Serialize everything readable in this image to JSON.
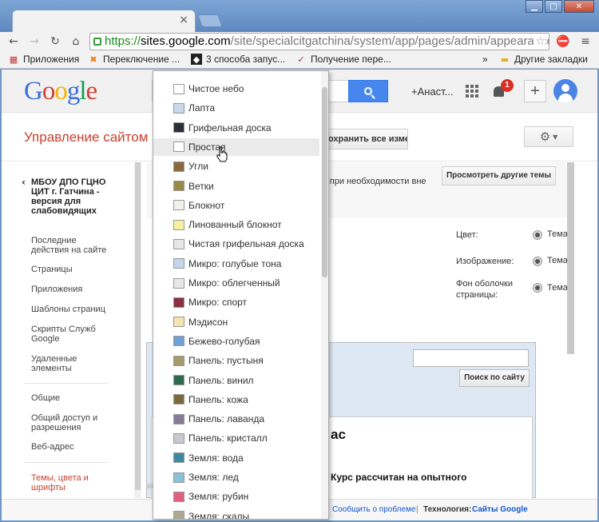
{
  "browser": {
    "tab_close": "×",
    "window_buttons": [
      "▁",
      "□",
      "✕"
    ],
    "url_https": "https://",
    "url_domain": "sites.google.com",
    "url_path": "/site/specialcitgatchina/system/app/pages/admin/appearance/tl",
    "bookmarks": [
      {
        "label": "Приложения",
        "icon": "apps-icon"
      },
      {
        "label": "Переключение ...",
        "icon": "joomla-icon"
      },
      {
        "label": "3 способа запус...",
        "icon": "diamond-icon"
      },
      {
        "label": "Получение пере...",
        "icon": "check-icon"
      }
    ],
    "bookmarks_more": "»",
    "other_bookmarks": "Другие закладки"
  },
  "google_bar": {
    "user": "+Анаст...",
    "notifications": "1"
  },
  "admin": {
    "title": "Управление сайтом",
    "save_all": "Сохранить все изменения"
  },
  "sidebar": {
    "site_name": "МБОУ ДПО ГЦНО ЦИТ г. Гатчина - версия для слабовидящих",
    "items": [
      "Последние действия на сайте",
      "Страницы",
      "Приложения",
      "Шаблоны страниц",
      "Скрипты Служб Google",
      "Удаленные элементы",
      "Общие",
      "Общий доступ и разрешения",
      "Веб-адрес",
      "Темы, цвета и шрифты"
    ]
  },
  "main": {
    "info_text": "у и при необходимости вне",
    "other_themes_button": "Просмотреть другие темы",
    "options": [
      {
        "label": "Цвет:",
        "value": "Тема"
      },
      {
        "label": "Изображение:",
        "value": "Тема"
      },
      {
        "label": "Фон оболочки страницы:",
        "value": "Тема"
      }
    ],
    "preview_search_button": "Поиск по сайту",
    "preview_heading": "ас",
    "preview_text": "Курс рассчитан на опытного"
  },
  "footer": {
    "report": "Сообщить о проблеме",
    "separator": "|",
    "tech_label": "Технология:",
    "tech_link": "Сайты Google"
  },
  "theme_dropdown": {
    "hovered": "Простая",
    "items": [
      {
        "label": "Чистое небо",
        "color": "#ffffff"
      },
      {
        "label": "Лапта",
        "color": "#c8d8ea"
      },
      {
        "label": "Грифельная доска",
        "color": "#2b2f36"
      },
      {
        "label": "Простая",
        "color": "#ffffff"
      },
      {
        "label": "Угли",
        "color": "#8a6a3c"
      },
      {
        "label": "Ветки",
        "color": "#9a8a4a"
      },
      {
        "label": "Блокнот",
        "color": "#f2f2e8"
      },
      {
        "label": "Линованный блокнот",
        "color": "#f4f0a0"
      },
      {
        "label": "Чистая грифельная доска",
        "color": "#e6e6e6"
      },
      {
        "label": "Микро: голубые тона",
        "color": "#c6d4ec"
      },
      {
        "label": "Микро: облегченный",
        "color": "#e8e8e8"
      },
      {
        "label": "Микро: спорт",
        "color": "#8a3040"
      },
      {
        "label": "Мэдисон",
        "color": "#f4e4b0"
      },
      {
        "label": "Бежево-голубая",
        "color": "#6fa0d8"
      },
      {
        "label": "Панель: пустыня",
        "color": "#a49a6a"
      },
      {
        "label": "Панель: винил",
        "color": "#2e6a4e"
      },
      {
        "label": "Панель: кожа",
        "color": "#7a6a3a"
      },
      {
        "label": "Панель: лаванда",
        "color": "#8a7a9a"
      },
      {
        "label": "Панель: кристалл",
        "color": "#c8c8d0"
      },
      {
        "label": "Земля: вода",
        "color": "#3a8aa0"
      },
      {
        "label": "Земля: лед",
        "color": "#8ac0d8"
      },
      {
        "label": "Земля: рубин",
        "color": "#e06080"
      },
      {
        "label": "Земля: скалы",
        "color": "#b0a890"
      }
    ]
  }
}
